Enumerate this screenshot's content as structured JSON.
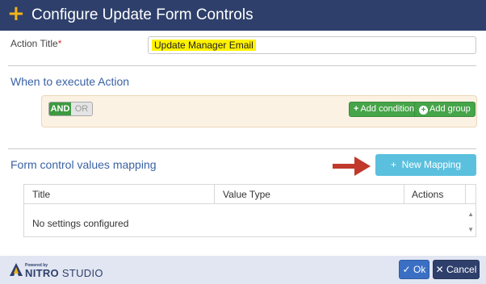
{
  "dialog": {
    "title": "Configure Update Form Controls",
    "plus_icon": "+"
  },
  "action_title": {
    "label": "Action Title",
    "required_mark": "*",
    "value": "Update Manager Email",
    "highlight_color": "#fff200"
  },
  "when_section": {
    "heading": "When to execute Action",
    "toggle": {
      "and_label": "AND",
      "or_label": "OR",
      "selected": "AND"
    },
    "add_condition_label": "Add condition",
    "add_group_label": "Add group"
  },
  "mapping_section": {
    "heading": "Form control values mapping",
    "new_mapping_label": "New Mapping",
    "columns": [
      "Title",
      "Value Type",
      "Actions"
    ],
    "empty_text": "No settings configured",
    "annotation_arrow_color": "#c0392b"
  },
  "footer": {
    "powered_by": "Powered by",
    "brand_primary": "NITRO",
    "brand_secondary": "STUDIO",
    "ok_label": "Ok",
    "cancel_label": "Cancel"
  },
  "colors": {
    "header_bg": "#2e3f6b",
    "accent_yellow": "#f3b21b",
    "section_blue": "#3a62a4",
    "green": "#46a449",
    "new_mapping_bg": "#5bc0de"
  }
}
